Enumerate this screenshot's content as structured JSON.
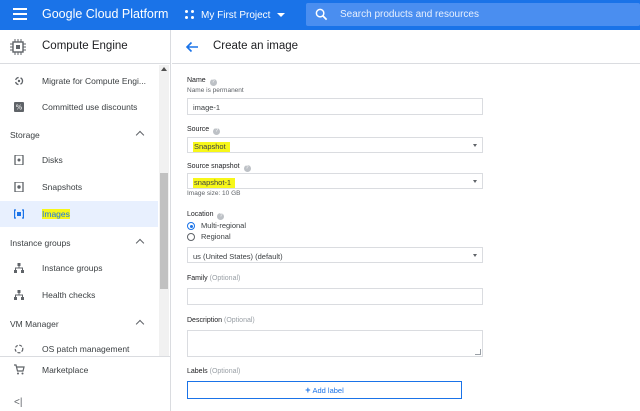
{
  "topbar": {
    "brand": "Google Cloud Platform",
    "project": "My First Project",
    "search_placeholder": "Search products and resources",
    "color": "#1a73e8"
  },
  "sidebar": {
    "title": "Compute Engine",
    "items": [
      {
        "label": "Migrate for Compute Engi...",
        "icon": "migrate-icon"
      },
      {
        "label": "Committed use discounts",
        "icon": "percent-icon"
      },
      {
        "label": "Storage",
        "type": "section"
      },
      {
        "label": "Disks",
        "icon": "disk-icon"
      },
      {
        "label": "Snapshots",
        "icon": "snapshot-icon"
      },
      {
        "label": "Images",
        "icon": "image-icon",
        "active": true,
        "highlighted": true
      },
      {
        "label": "Instance groups",
        "type": "section"
      },
      {
        "label": "Instance groups",
        "icon": "instance-groups-icon"
      },
      {
        "label": "Health checks",
        "icon": "health-check-icon"
      },
      {
        "label": "VM Manager",
        "type": "section"
      },
      {
        "label": "OS patch management",
        "icon": "patch-icon"
      }
    ],
    "marketplace": "Marketplace",
    "collapse": "<|"
  },
  "main": {
    "title": "Create an image",
    "fields": {
      "name": {
        "label": "Name",
        "hint": "Name is permanent",
        "value": "image-1"
      },
      "source": {
        "label": "Source",
        "value": "Snapshot"
      },
      "source_snapshot": {
        "label": "Source snapshot",
        "value": "snapshot-1",
        "hint": "Image size: 10 GB"
      },
      "location": {
        "label": "Location",
        "options": [
          "Multi-regional",
          "Regional"
        ],
        "selected": "Multi-regional",
        "region_value": "us (United States) (default)"
      },
      "family": {
        "label": "Family",
        "optional": "(Optional)",
        "value": ""
      },
      "description": {
        "label": "Description",
        "optional": "(Optional)",
        "value": ""
      },
      "labels": {
        "label": "Labels",
        "optional": "(Optional)",
        "button": "Add label"
      }
    }
  },
  "highlight_color": "#f7f719"
}
